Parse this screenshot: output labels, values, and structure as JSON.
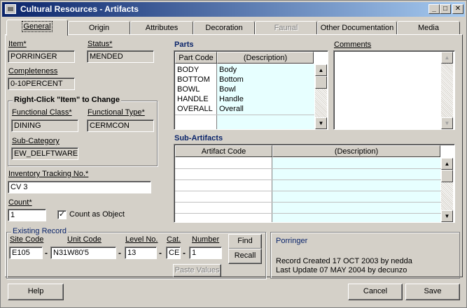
{
  "window": {
    "title": "Cultural Resources - Artifacts"
  },
  "tabs": [
    {
      "label": "General",
      "state": "active"
    },
    {
      "label": "Origin",
      "state": "normal"
    },
    {
      "label": "Attributes",
      "state": "normal"
    },
    {
      "label": "Decoration",
      "state": "normal"
    },
    {
      "label": "Faunal",
      "state": "disabled"
    },
    {
      "label": "Other Documentation",
      "state": "normal"
    },
    {
      "label": "Media",
      "state": "normal"
    }
  ],
  "general": {
    "item_label": "Item*",
    "item_value": "PORRINGER",
    "status_label": "Status*",
    "status_value": "MENDED",
    "completeness_label": "Completeness",
    "completeness_value": "0-10PERCENT",
    "rightclick_title": "Right-Click \"Item\" to Change",
    "functional_class_label": "Functional Class*",
    "functional_class_value": "DINING",
    "functional_type_label": "Functional Type*",
    "functional_type_value": "CERMCON",
    "subcategory_label": "Sub-Category",
    "subcategory_value": "EW_DELFTWARE",
    "inventory_label": "Inventory Tracking No.*",
    "inventory_value": "CV 3",
    "count_label": "Count*",
    "count_value": "1",
    "count_as_object_label": "Count as Object",
    "count_as_object_checked": "✓"
  },
  "parts": {
    "title": "Parts",
    "columns": [
      "Part Code",
      "(Description)"
    ],
    "rows": [
      {
        "code": "BODY",
        "desc": "Body"
      },
      {
        "code": "BOTTOM",
        "desc": "Bottom"
      },
      {
        "code": "BOWL",
        "desc": "Bowl"
      },
      {
        "code": "HANDLE",
        "desc": "Handle"
      },
      {
        "code": "OVERALL",
        "desc": "Overall"
      }
    ]
  },
  "comments": {
    "label": "Comments"
  },
  "subartifacts": {
    "title": "Sub-Artifacts",
    "columns": [
      "Artifact Code",
      "(Description)"
    ]
  },
  "existing_record": {
    "title": "Existing Record",
    "site_code_label": "Site Code",
    "site_code_value": "E105",
    "unit_code_label": "Unit Code",
    "unit_code_value": "N31W80'5",
    "level_label": "Level No.",
    "level_value": "13",
    "cat_label": "Cat.",
    "cat_value": "CE",
    "number_label": "Number",
    "number_value": "1",
    "find_label": "Find",
    "recall_label": "Recall",
    "paste_values_label": "Paste Values"
  },
  "record_info": {
    "name": "Porringer",
    "created": "Record Created 17 OCT 2003 by nedda",
    "updated": "Last Update 07 MAY 2004 by decunzo"
  },
  "buttons": {
    "help": "Help",
    "cancel": "Cancel",
    "save": "Save"
  },
  "titlebar_buttons": {
    "minimize": "_",
    "maximize": "□",
    "close": "✕"
  },
  "scroll_glyphs": {
    "up": "▲",
    "down": "▼"
  }
}
